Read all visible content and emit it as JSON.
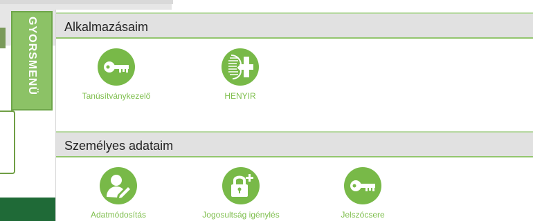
{
  "quick_menu": {
    "label": "GYORSMENÜ"
  },
  "sections": [
    {
      "title": "Alkalmazásaim",
      "apps": [
        {
          "label": "Tanúsítványkezelő",
          "icon": "key-icon"
        },
        {
          "label": "HENYIR",
          "icon": "henyir-logo-icon"
        }
      ]
    },
    {
      "title": "Személyes adataim",
      "apps": [
        {
          "label": "Adatmódosítás",
          "icon": "user-edit-icon"
        },
        {
          "label": "Jogosultság igénylés",
          "icon": "lock-plus-icon"
        },
        {
          "label": "Jelszócsere",
          "icon": "key-icon"
        }
      ]
    }
  ],
  "colors": {
    "accent": "#78b948",
    "tab": "#8cc266",
    "label": "#7fbf4e",
    "header_bg": "#e1e1e1",
    "footer": "#1f6a37"
  }
}
